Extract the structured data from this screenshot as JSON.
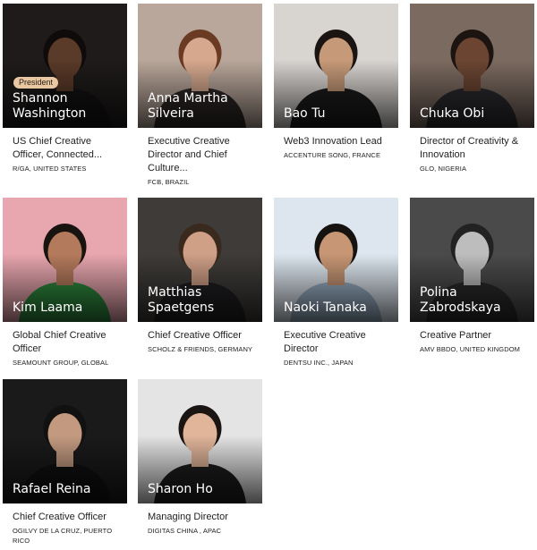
{
  "people": [
    {
      "name": "Shannon Washington",
      "role": "US Chief Creative Officer, Connected...",
      "agency": "R/GA, UNITED STATES",
      "badge": "President",
      "bg": "#1e1b1a",
      "skin": "#5a3a28",
      "hair": "#0e0b0a",
      "shirt": "#141212"
    },
    {
      "name": "Anna Martha Silveira",
      "role": "Executive Creative Director and Chief Culture...",
      "agency": "FCB, BRAZIL",
      "bg": "#b9a79b",
      "skin": "#d6a98e",
      "hair": "#6a3a22",
      "shirt": "#2e2826"
    },
    {
      "name": "Bao Tu",
      "role": "Web3 Innovation Lead",
      "agency": "ACCENTURE SONG, FRANCE",
      "bg": "#d8d4d0",
      "skin": "#c69a78",
      "hair": "#1a1512",
      "shirt": "#1c1c1e"
    },
    {
      "name": "Chuka Obi",
      "role": "Director of Creativity & Innovation",
      "agency": "GLO, NIGERIA",
      "bg": "#7b6a60",
      "skin": "#6b4532",
      "hair": "#1c1410",
      "shirt": "#2b2a2e"
    },
    {
      "name": "Kim Laama",
      "role": "Global Chief Creative Officer",
      "agency": "SEAMOUNT GROUP, GLOBAL",
      "bg": "#e8a6ae",
      "skin": "#b47a5c",
      "hair": "#1a1410",
      "shirt": "#2f8a3e"
    },
    {
      "name": "Matthias Spaetgens",
      "role": "Chief Creative Officer",
      "agency": "SCHOLZ & FRIENDS, GERMANY",
      "bg": "#3e3b38",
      "skin": "#cf9f86",
      "hair": "#3a2a1e",
      "shirt": "#1f1f22"
    },
    {
      "name": "Naoki Tanaka",
      "role": "Executive Creative Director",
      "agency": "DENTSU INC., JAPAN",
      "bg": "#dde6ef",
      "skin": "#c79674",
      "hair": "#151210",
      "shirt": "#9ab0c6"
    },
    {
      "name": "Polina Zabrodskaya",
      "role": "Creative Partner",
      "agency": "AMV BBDO, UNITED KINGDOM",
      "bg": "#4a4a4a",
      "skin": "#bdbdbd",
      "hair": "#222222",
      "shirt": "#2a2a2a"
    },
    {
      "name": "Rafael Reina",
      "role": "Chief Creative Officer",
      "agency": "OGILVY DE LA CRUZ, PUERTO RICO",
      "bg": "#1a1a1a",
      "skin": "#c39a80",
      "hair": "#111111",
      "shirt": "#101010"
    },
    {
      "name": "Sharon Ho",
      "role": "Managing Director",
      "agency": "DIGITAS CHINA , APAC",
      "bg": "#e4e4e4",
      "skin": "#e0b59a",
      "hair": "#1a1412",
      "shirt": "#1e1e1e"
    }
  ]
}
